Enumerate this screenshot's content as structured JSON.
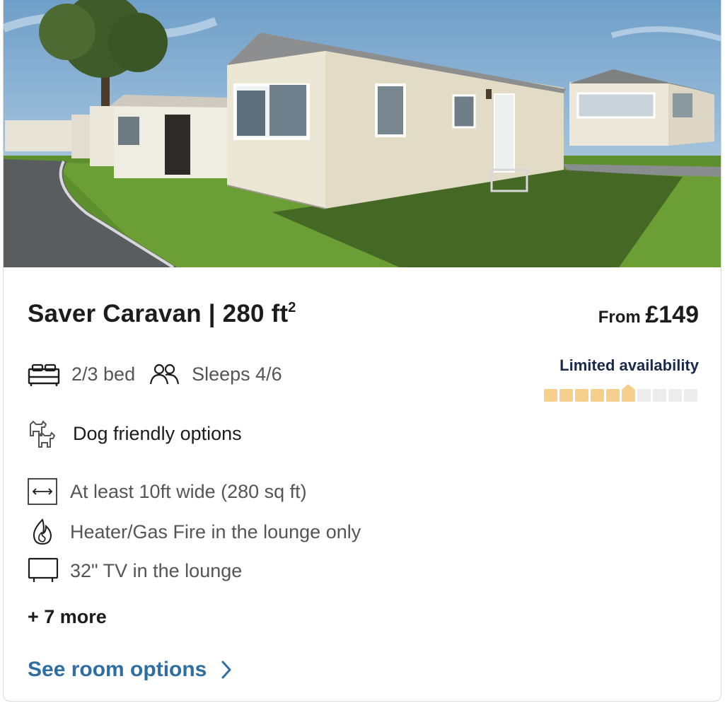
{
  "listing": {
    "title": "Saver Caravan | 280 ft",
    "title_sup": "2",
    "price_prefix": "From",
    "price_amount": "£149",
    "availability_label": "Limited availability",
    "availability_level": 0.6,
    "bed": "2/3 bed",
    "sleeps": "Sleeps 4/6",
    "dog": "Dog friendly options",
    "width": "At least 10ft wide (280 sq ft)",
    "heater": "Heater/Gas Fire in the lounge only",
    "tv": "32\" TV in the lounge",
    "more": "+ 7 more",
    "cta": "See room options"
  },
  "colors": {
    "accent": "#2e6ea3",
    "availability_filled": "#f6cf8c",
    "availability_empty": "#ececec"
  }
}
